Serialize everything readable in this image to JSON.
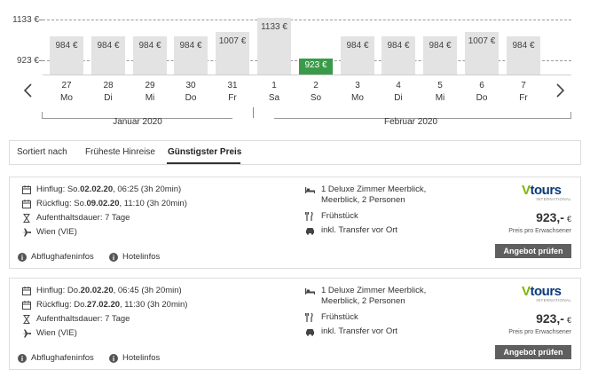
{
  "chart": {
    "axis_high": "1133 €",
    "axis_low": "923 €",
    "bars": [
      {
        "price": "984 €",
        "value": 984,
        "day": "27",
        "weekday": "Mo",
        "best": false
      },
      {
        "price": "984 €",
        "value": 984,
        "day": "28",
        "weekday": "Di",
        "best": false
      },
      {
        "price": "984 €",
        "value": 984,
        "day": "29",
        "weekday": "Mi",
        "best": false
      },
      {
        "price": "984 €",
        "value": 984,
        "day": "30",
        "weekday": "Do",
        "best": false
      },
      {
        "price": "1007 €",
        "value": 1007,
        "day": "31",
        "weekday": "Fr",
        "best": false
      },
      {
        "price": "1133 €",
        "value": 1133,
        "day": "1",
        "weekday": "Sa",
        "best": false
      },
      {
        "price": "923 €",
        "value": 923,
        "day": "2",
        "weekday": "So",
        "best": true
      },
      {
        "price": "984 €",
        "value": 984,
        "day": "3",
        "weekday": "Mo",
        "best": false
      },
      {
        "price": "984 €",
        "value": 984,
        "day": "4",
        "weekday": "Di",
        "best": false
      },
      {
        "price": "984 €",
        "value": 984,
        "day": "5",
        "weekday": "Mi",
        "best": false
      },
      {
        "price": "1007 €",
        "value": 1007,
        "day": "6",
        "weekday": "Do",
        "best": false
      },
      {
        "price": "984 €",
        "value": 984,
        "day": "7",
        "weekday": "Fr",
        "best": false
      }
    ],
    "month_left": "Januar 2020",
    "month_right": "Februar 2020",
    "best_color": "#3a9a4a",
    "bar_color": "#e3e3e3"
  },
  "sort": {
    "label": "Sortiert nach",
    "option_earliest": "Früheste Hinreise",
    "option_cheapest": "Günstigster Preis"
  },
  "offers": [
    {
      "outbound_prefix": "Hinflug: So. ",
      "outbound_date": "02.02.20",
      "outbound_suffix": ", 06:25 (3h 20min)",
      "return_prefix": "Rückflug: So. ",
      "return_date": "09.02.20",
      "return_suffix": ", 11:10 (3h 20min)",
      "stay": "Aufenthaltsdauer: 7 Tage",
      "airport": "Wien (VIE)",
      "room": "1 Deluxe Zimmer Meerblick, Meerblick, 2 Personen",
      "board": "Frühstück",
      "transfer": "inkl. Transfer vor Ort",
      "brand_v": "V",
      "brand_rest": "tours",
      "brand_sub": "INTERNATIONAL",
      "price": "923,-",
      "currency": "€",
      "price_note": "Preis pro Erwachsener",
      "cta": "Angebot prüfen",
      "airport_info": "Abflughafeninfos",
      "hotel_info": "Hotelinfos"
    },
    {
      "outbound_prefix": "Hinflug: Do. ",
      "outbound_date": "20.02.20",
      "outbound_suffix": ", 06:45 (3h 20min)",
      "return_prefix": "Rückflug: Do. ",
      "return_date": "27.02.20",
      "return_suffix": ", 11:30 (3h 20min)",
      "stay": "Aufenthaltsdauer: 7 Tage",
      "airport": "Wien (VIE)",
      "room": "1 Deluxe Zimmer Meerblick, Meerblick, 2 Personen",
      "board": "Frühstück",
      "transfer": "inkl. Transfer vor Ort",
      "brand_v": "V",
      "brand_rest": "tours",
      "brand_sub": "INTERNATIONAL",
      "price": "923,-",
      "currency": "€",
      "price_note": "Preis pro Erwachsener",
      "cta": "Angebot prüfen",
      "airport_info": "Abflughafeninfos",
      "hotel_info": "Hotelinfos"
    }
  ]
}
